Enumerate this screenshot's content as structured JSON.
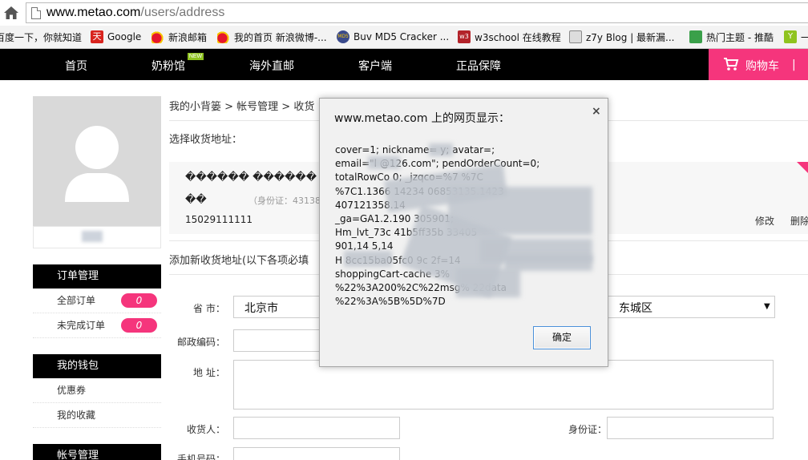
{
  "browser": {
    "url_host": "www.metao.com",
    "url_path": "/users/address",
    "bookmarks": [
      {
        "label": "百度一下，你就知道",
        "icon": "baidu-icon",
        "color": "#ffffff"
      },
      {
        "label": "Google",
        "icon": "google-icon",
        "color": "#d8241e"
      },
      {
        "label": "新浪邮箱",
        "icon": "sina-mail-icon",
        "color": "#e6162d"
      },
      {
        "label": "我的首页 新浪微博-...",
        "icon": "weibo-icon",
        "color": "#e6162d"
      },
      {
        "label": "Buv MD5 Cracker ...",
        "icon": "md5-icon",
        "color": "#3a4a8c"
      },
      {
        "label": "w3school 在线教程",
        "icon": "w3school-icon",
        "color": "#b3232a"
      },
      {
        "label": "z7y Blog | 最新漏...",
        "icon": "z7y-icon",
        "color": "#888888"
      },
      {
        "label": "热门主题 - 推酷",
        "icon": "tuicool-icon",
        "color": "#3aa04a"
      },
      {
        "label": "一",
        "icon": "yi-icon",
        "color": "#8fc31f"
      }
    ]
  },
  "nav": {
    "items": [
      "首页",
      "奶粉馆",
      "海外直邮",
      "客户端",
      "正品保障"
    ],
    "new_badge": "NEW",
    "cart_label": "购物车",
    "cart_sep": "|"
  },
  "sidebar": {
    "orders_head": "订单管理",
    "orders": [
      {
        "label": "全部订单",
        "count": "0"
      },
      {
        "label": "未完成订单",
        "count": "0"
      }
    ],
    "wallet_head": "我的钱包",
    "wallet": [
      "优惠券",
      "我的收藏"
    ],
    "account_head": "帐号管理"
  },
  "main": {
    "breadcrumb": "我的小背篓 > 帐号管理 > 收货",
    "select_title": "选择收货地址：",
    "card": {
      "line1": "������ ������ ←",
      "line2": "��",
      "id_label": "（身份证：43138",
      "phone": "15029111111",
      "edit": "修改",
      "delete": "删除"
    },
    "add_title": "添加新收货地址(以下各项必填",
    "form": {
      "province_label": "省 市：",
      "province_value": "北京市",
      "district_value": "东城区",
      "postcode_label": "邮政编码：",
      "address_label": "地 址：",
      "receiver_label": "收货人：",
      "idcard_label": "身份证：",
      "phone_label": "手机号码："
    }
  },
  "dialog": {
    "title": "www.metao.com 上的网页显示：",
    "close": "×",
    "lines": [
      "cover=1; nickname=        y; avatar=;",
      "email=\"l        @126.com\"; pendOrderCount=0;",
      "totalRowCo        0; _jzqco=%7        %7C",
      "%7C1.1366        14234                06853135.1423",
      "407121358.14",
      "_ga=GA1.2.190                   305901;",
      "Hm_lvt_73c              41b5ff35b        33405",
      "901,14         5,14",
      "H      8cc15ba05fc0       9c          2f=14",
      "       shoppingCart-cache       3%",
      "%22%3A200%2C%22msg%                 22data",
      "%22%3A%5B%5D%7D"
    ],
    "ok": "确定"
  }
}
